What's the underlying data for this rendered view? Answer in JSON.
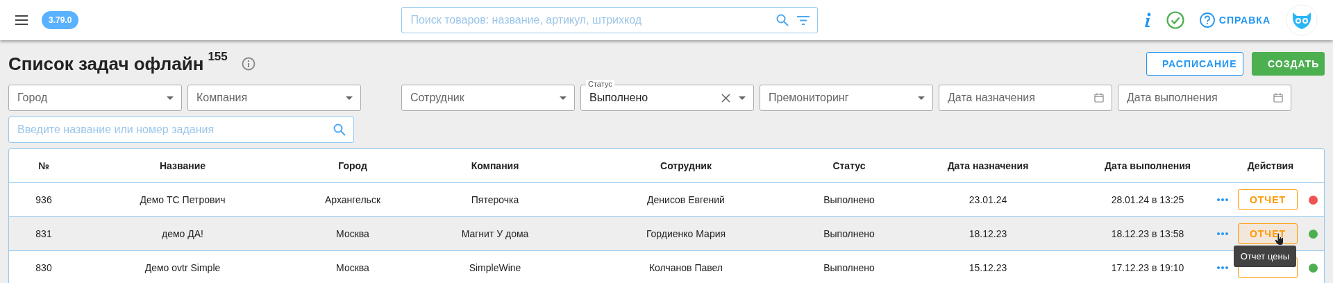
{
  "header": {
    "version": "3.79.0",
    "search": {
      "placeholder": "Поиск товаров: название, артикул, штрихкод"
    },
    "help": "СПРАВКА"
  },
  "page": {
    "title": "Список задач офлайн",
    "count": "155",
    "buttons": [
      {
        "label": "РАСПИСАНИЕ",
        "kind": "outline"
      },
      {
        "label": "СОЗДАТЬ",
        "kind": "primary"
      }
    ]
  },
  "filters": [
    {
      "kind": "select",
      "placeholder": "Город"
    },
    {
      "kind": "select",
      "placeholder": "Компания"
    },
    {
      "kind": "select",
      "placeholder": "Сотрудник"
    },
    {
      "kind": "select",
      "label": "Статус",
      "value": "Выполнено"
    },
    {
      "kind": "select",
      "placeholder": "Премониторинг"
    },
    {
      "kind": "date",
      "placeholder": "Дата назначения"
    },
    {
      "kind": "date",
      "placeholder": "Дата выполнения"
    }
  ],
  "task_search": {
    "placeholder": "Введите название или номер задания"
  },
  "table": {
    "columns": [
      "№",
      "Название",
      "Город",
      "Компания",
      "Сотрудник",
      "Статус",
      "Дата назначения",
      "Дата выполнения",
      "Действия"
    ],
    "rows": [
      {
        "cells": [
          "936",
          "Демо ТС Петрович",
          "Архангельск",
          "Пятерочка",
          "Денисов Евгений",
          "Выполнено",
          "23.01.24",
          "28.01.24 в 13:25"
        ],
        "report": "ОТЧЕТ",
        "hovered": false,
        "color": "#ef5350"
      },
      {
        "cells": [
          "831",
          "демо ДА!",
          "Москва",
          "Магнит У дома",
          "Гордиенко Мария",
          "Выполнено",
          "18.12.23",
          "18.12.23 в 13:58"
        ],
        "report": "ОТЧЕТ",
        "hovered": true,
        "color": "#4caf50"
      },
      {
        "cells": [
          "830",
          "Демо ovtr Simple",
          "Москва",
          "SimpleWine",
          "Колчанов Павел",
          "Выполнено",
          "15.12.23",
          "17.12.23 в 19:10"
        ],
        "hovered": false,
        "color": "#4caf50"
      }
    ]
  },
  "tooltip": "Отчет цены"
}
